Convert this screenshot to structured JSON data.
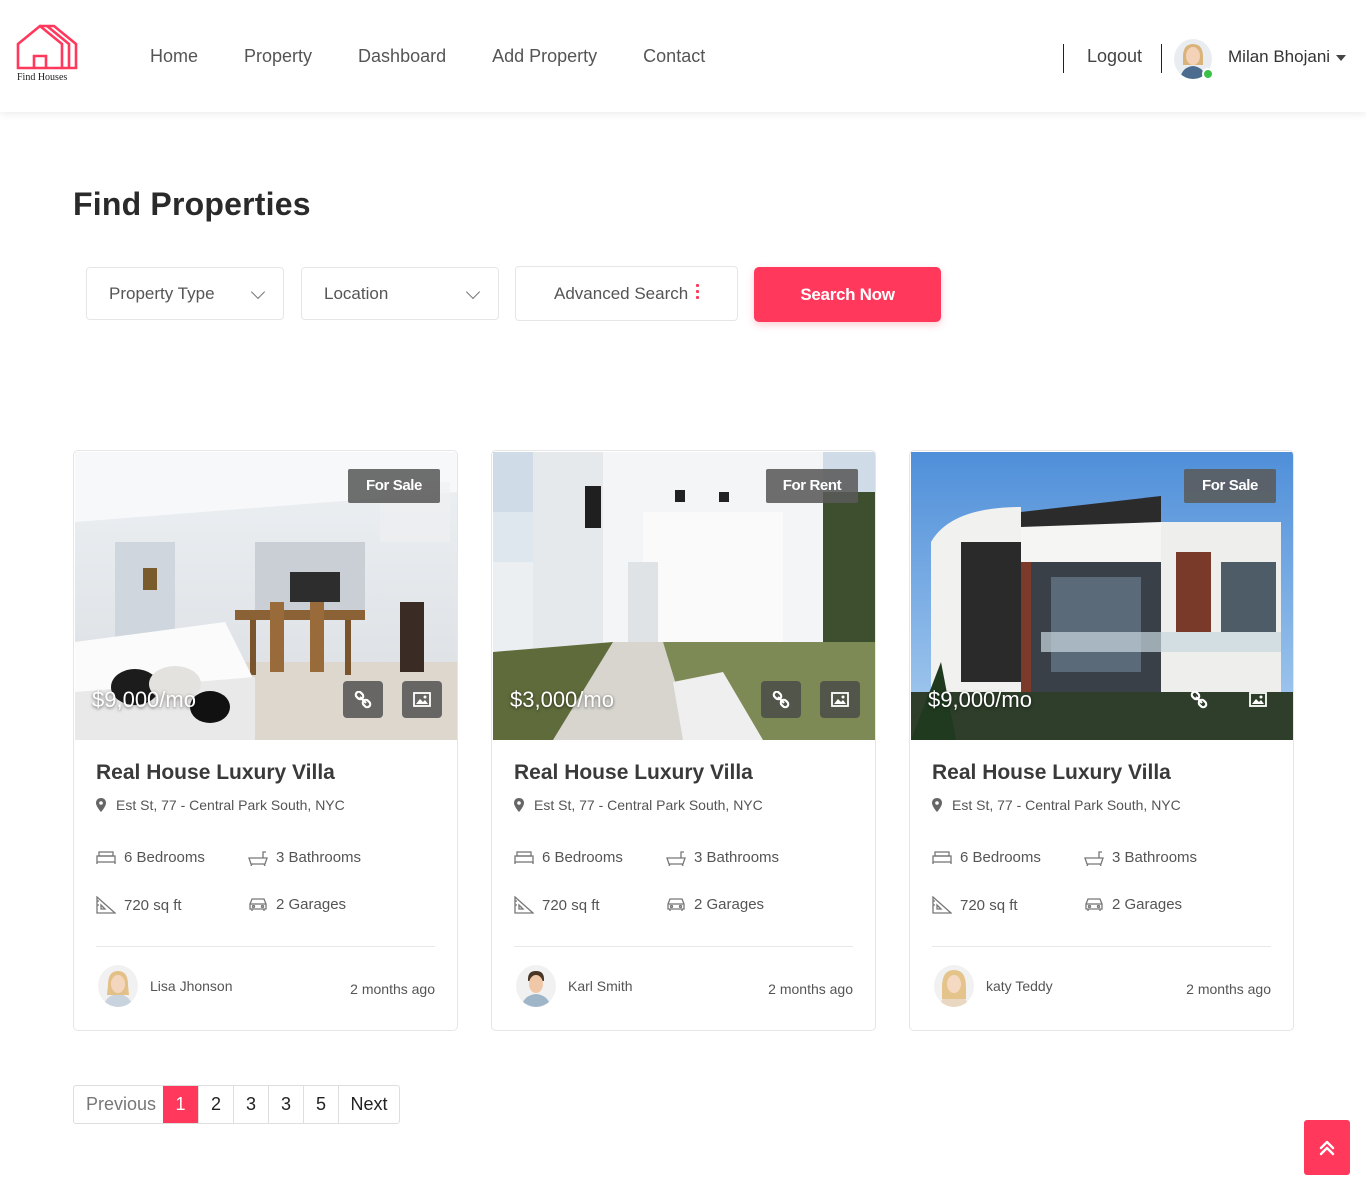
{
  "brand": {
    "name": "Find Houses",
    "color": "#ff385c"
  },
  "nav": {
    "items": [
      {
        "label": "Home"
      },
      {
        "label": "Property"
      },
      {
        "label": "Dashboard"
      },
      {
        "label": "Add Property"
      },
      {
        "label": "Contact"
      }
    ],
    "logout_label": "Logout",
    "user": {
      "name": "Milan Bhojani",
      "online": true
    }
  },
  "page_title": "Find Properties",
  "search": {
    "property_type": "Property Type",
    "location": "Location",
    "advanced": "Advanced Search",
    "button": "Search Now"
  },
  "listings": [
    {
      "badge": "For Sale",
      "price": "$9,000/mo",
      "title": "Real House Luxury Villa",
      "address": "Est St, 77 - Central Park South, NYC",
      "bedrooms": "6 Bedrooms",
      "bathrooms": "3 Bathrooms",
      "area": "720 sq ft",
      "garages": "2 Garages",
      "agent": "Lisa Jhonson",
      "posted": "2 months ago"
    },
    {
      "badge": "For Rent",
      "price": "$3,000/mo",
      "title": "Real House Luxury Villa",
      "address": "Est St, 77 - Central Park South, NYC",
      "bedrooms": "6 Bedrooms",
      "bathrooms": "3 Bathrooms",
      "area": "720 sq ft",
      "garages": "2 Garages",
      "agent": "Karl Smith",
      "posted": "2 months ago"
    },
    {
      "badge": "For Sale",
      "price": "$9,000/mo",
      "title": "Real House Luxury Villa",
      "address": "Est St, 77 - Central Park South, NYC",
      "bedrooms": "6 Bedrooms",
      "bathrooms": "3 Bathrooms",
      "area": "720 sq ft",
      "garages": "2 Garages",
      "agent": "katy Teddy",
      "posted": "2 months ago"
    }
  ],
  "pagination": {
    "previous": "Previous",
    "pages": [
      "1",
      "2",
      "3",
      "3",
      "5"
    ],
    "current": "1",
    "next": "Next"
  },
  "icons": {
    "logo": "house-logo-icon",
    "dropdown": "chevron-down-icon",
    "advanced": "vertical-dots-icon",
    "pin": "map-pin-icon",
    "bed": "bed-icon",
    "bath": "bathtub-icon",
    "area": "ruler-triangle-icon",
    "garage": "car-icon",
    "link": "link-icon",
    "image": "image-icon",
    "to_top": "double-chevron-up-icon"
  }
}
